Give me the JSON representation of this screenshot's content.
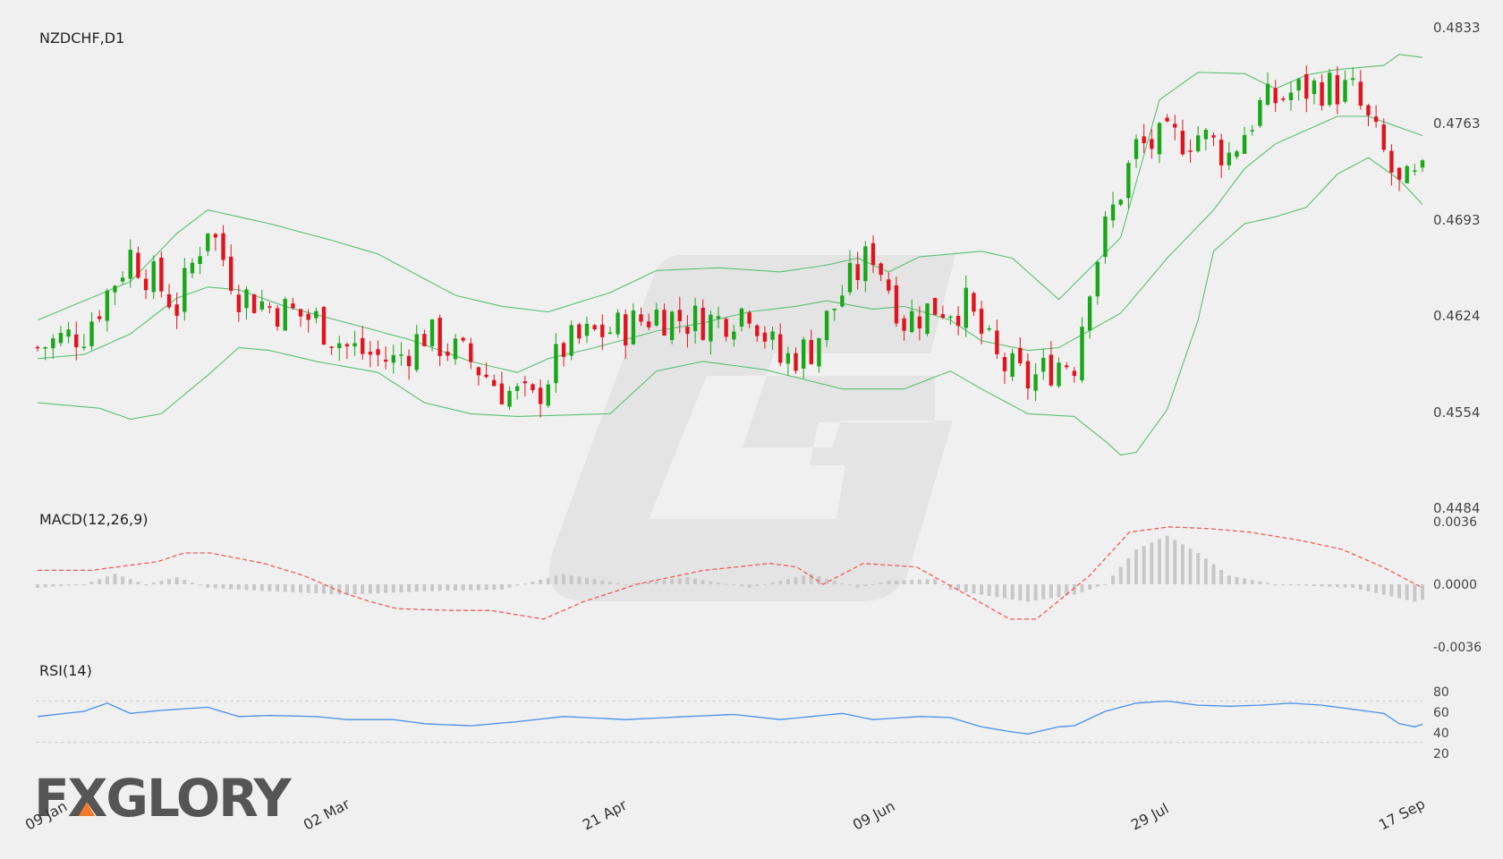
{
  "chart_data": [
    {
      "type": "candlestick",
      "title": "NZDCHF,D1",
      "y_ticks": [
        "0.4833",
        "0.4763",
        "0.4693",
        "0.4624",
        "0.4554",
        "0.4484"
      ],
      "ylim": [
        0.4484,
        0.4833
      ],
      "x_tick_labels": [
        "09 Jan",
        "02 Mar",
        "21 Apr",
        "09 Jun",
        "29 Jul",
        "17 Sep"
      ],
      "bar_count": 180,
      "colors": {
        "up": "#19a619",
        "down": "#e0141e",
        "bollinger": "#5cbf74"
      },
      "bollinger": {
        "upper_anchors": [
          [
            0,
            0.462
          ],
          [
            12,
            0.4648
          ],
          [
            18,
            0.4683
          ],
          [
            22,
            0.47
          ],
          [
            26,
            0.4695
          ],
          [
            30,
            0.469
          ],
          [
            38,
            0.4678
          ],
          [
            44,
            0.4668
          ],
          [
            48,
            0.4656
          ],
          [
            54,
            0.4638
          ],
          [
            60,
            0.463
          ],
          [
            66,
            0.4626
          ],
          [
            74,
            0.464
          ],
          [
            80,
            0.4656
          ],
          [
            88,
            0.4658
          ],
          [
            96,
            0.4655
          ],
          [
            102,
            0.466
          ],
          [
            106,
            0.4665
          ],
          [
            110,
            0.4655
          ],
          [
            114,
            0.4666
          ],
          [
            118,
            0.4668
          ],
          [
            122,
            0.467
          ],
          [
            126,
            0.4665
          ],
          [
            128,
            0.4655
          ],
          [
            132,
            0.4635
          ],
          [
            140,
            0.468
          ],
          [
            145,
            0.478
          ],
          [
            150,
            0.48
          ],
          [
            156,
            0.4799
          ],
          [
            160,
            0.4788
          ],
          [
            164,
            0.4798
          ],
          [
            168,
            0.4802
          ],
          [
            174,
            0.4805
          ],
          [
            176,
            0.4813
          ],
          [
            180,
            0.481
          ]
        ],
        "middle_anchors": [
          [
            0,
            0.4592
          ],
          [
            6,
            0.4595
          ],
          [
            12,
            0.461
          ],
          [
            18,
            0.4636
          ],
          [
            22,
            0.4644
          ],
          [
            26,
            0.4642
          ],
          [
            32,
            0.463
          ],
          [
            40,
            0.4618
          ],
          [
            48,
            0.4606
          ],
          [
            56,
            0.459
          ],
          [
            62,
            0.4582
          ],
          [
            66,
            0.4592
          ],
          [
            72,
            0.46
          ],
          [
            80,
            0.4612
          ],
          [
            86,
            0.4618
          ],
          [
            92,
            0.4626
          ],
          [
            98,
            0.463
          ],
          [
            102,
            0.4634
          ],
          [
            108,
            0.4628
          ],
          [
            112,
            0.463
          ],
          [
            118,
            0.462
          ],
          [
            122,
            0.4605
          ],
          [
            128,
            0.4598
          ],
          [
            132,
            0.46
          ],
          [
            140,
            0.4625
          ],
          [
            146,
            0.4665
          ],
          [
            152,
            0.47
          ],
          [
            156,
            0.473
          ],
          [
            160,
            0.4748
          ],
          [
            164,
            0.4758
          ],
          [
            168,
            0.4768
          ],
          [
            172,
            0.4768
          ],
          [
            176,
            0.476
          ],
          [
            180,
            0.4752
          ]
        ],
        "lower_anchors": [
          [
            0,
            0.456
          ],
          [
            8,
            0.4556
          ],
          [
            12,
            0.4548
          ],
          [
            16,
            0.4552
          ],
          [
            22,
            0.458
          ],
          [
            26,
            0.46
          ],
          [
            30,
            0.4598
          ],
          [
            36,
            0.459
          ],
          [
            44,
            0.4582
          ],
          [
            50,
            0.456
          ],
          [
            56,
            0.4552
          ],
          [
            62,
            0.455
          ],
          [
            74,
            0.4552
          ],
          [
            80,
            0.4583
          ],
          [
            86,
            0.459
          ],
          [
            94,
            0.4584
          ],
          [
            104,
            0.457
          ],
          [
            112,
            0.457
          ],
          [
            118,
            0.4583
          ],
          [
            122,
            0.457
          ],
          [
            128,
            0.4552
          ],
          [
            134,
            0.455
          ],
          [
            138,
            0.4532
          ],
          [
            140,
            0.4522
          ],
          [
            142,
            0.4524
          ],
          [
            146,
            0.4555
          ],
          [
            150,
            0.462
          ],
          [
            152,
            0.467
          ],
          [
            156,
            0.469
          ],
          [
            160,
            0.4695
          ],
          [
            164,
            0.4702
          ],
          [
            168,
            0.4726
          ],
          [
            172,
            0.4738
          ],
          [
            176,
            0.4722
          ],
          [
            180,
            0.4698
          ]
        ]
      },
      "price_anchors": [
        [
          0,
          0.46
        ],
        [
          6,
          0.4612
        ],
        [
          12,
          0.4668
        ],
        [
          18,
          0.463
        ],
        [
          22,
          0.469
        ],
        [
          26,
          0.464
        ],
        [
          30,
          0.463
        ],
        [
          36,
          0.462
        ],
        [
          40,
          0.46
        ],
        [
          46,
          0.459
        ],
        [
          50,
          0.461
        ],
        [
          56,
          0.459
        ],
        [
          60,
          0.457
        ],
        [
          64,
          0.456
        ],
        [
          68,
          0.46
        ],
        [
          72,
          0.461
        ],
        [
          76,
          0.4615
        ],
        [
          80,
          0.4625
        ],
        [
          84,
          0.462
        ],
        [
          88,
          0.462
        ],
        [
          92,
          0.463
        ],
        [
          96,
          0.459
        ],
        [
          100,
          0.46
        ],
        [
          104,
          0.464
        ],
        [
          108,
          0.467
        ],
        [
          112,
          0.462
        ],
        [
          116,
          0.463
        ],
        [
          120,
          0.463
        ],
        [
          124,
          0.459
        ],
        [
          128,
          0.4575
        ],
        [
          132,
          0.459
        ],
        [
          134,
          0.459
        ],
        [
          136,
          0.465
        ],
        [
          138,
          0.4685
        ],
        [
          142,
          0.4745
        ],
        [
          150,
          0.4755
        ],
        [
          154,
          0.474
        ],
        [
          158,
          0.4775
        ],
        [
          162,
          0.4785
        ],
        [
          166,
          0.479
        ],
        [
          170,
          0.4785
        ],
        [
          174,
          0.474
        ],
        [
          176,
          0.4715
        ],
        [
          180,
          0.4725
        ]
      ]
    },
    {
      "type": "line",
      "title": "MACD(12,26,9)",
      "y_ticks": [
        "0.0036",
        "0.0000",
        "-0.0036"
      ],
      "ylim": [
        -0.0036,
        0.0036
      ],
      "colors": {
        "signal": "#f05a5a",
        "histogram": "#c8c8c8"
      },
      "signal_anchors": [
        [
          0,
          0.0008
        ],
        [
          8,
          0.0008
        ],
        [
          12,
          0.001
        ],
        [
          18,
          0.0013
        ],
        [
          22,
          0.0018
        ],
        [
          26,
          0.0018
        ],
        [
          34,
          0.0012
        ],
        [
          40,
          0.0005
        ],
        [
          46,
          -0.0005
        ],
        [
          50,
          -0.001
        ],
        [
          54,
          -0.0014
        ],
        [
          62,
          -0.0015
        ],
        [
          68,
          -0.0015
        ],
        [
          76,
          -0.002
        ],
        [
          82,
          -0.001
        ],
        [
          90,
          0.0
        ],
        [
          100,
          0.0008
        ],
        [
          110,
          0.0012
        ],
        [
          114,
          0.001
        ],
        [
          118,
          0.0
        ],
        [
          124,
          0.0012
        ],
        [
          132,
          0.001
        ],
        [
          140,
          -0.0007
        ],
        [
          146,
          -0.002
        ],
        [
          150,
          -0.002
        ],
        [
          158,
          0.0005
        ],
        [
          164,
          0.003
        ],
        [
          170,
          0.0033
        ],
        [
          176,
          0.0032
        ],
        [
          182,
          0.003
        ],
        [
          190,
          0.0025
        ],
        [
          196,
          0.002
        ],
        [
          202,
          0.001
        ],
        [
          208,
          -0.0002
        ]
      ],
      "histogram_anchors": [
        [
          0,
          -0.0002
        ],
        [
          6,
          0.0
        ],
        [
          10,
          0.0006
        ],
        [
          14,
          0.0
        ],
        [
          18,
          0.0004
        ],
        [
          22,
          -0.0002
        ],
        [
          30,
          -0.0004
        ],
        [
          40,
          -0.0006
        ],
        [
          50,
          -0.0004
        ],
        [
          60,
          -0.0003
        ],
        [
          68,
          0.0006
        ],
        [
          76,
          0.0
        ],
        [
          84,
          0.0004
        ],
        [
          92,
          -0.0002
        ],
        [
          100,
          0.0006
        ],
        [
          106,
          -0.0002
        ],
        [
          110,
          0.0002
        ],
        [
          116,
          0.0003
        ],
        [
          118,
          -0.0003
        ],
        [
          122,
          -0.0006
        ],
        [
          128,
          -0.001
        ],
        [
          134,
          -0.0006
        ],
        [
          138,
          0.0
        ],
        [
          142,
          0.002
        ],
        [
          146,
          0.0028
        ],
        [
          150,
          0.0018
        ],
        [
          154,
          0.0005
        ],
        [
          160,
          0.0
        ],
        [
          170,
          -0.0002
        ],
        [
          174,
          -0.0006
        ],
        [
          178,
          -0.001
        ],
        [
          180,
          -0.0008
        ]
      ]
    },
    {
      "type": "line",
      "title": "RSI(14)",
      "y_ticks": [
        "80",
        "60",
        "40",
        "20"
      ],
      "ylim": [
        20,
        80
      ],
      "levels": [
        70,
        30
      ],
      "color": "#4a8fe8",
      "anchors": [
        [
          0,
          55
        ],
        [
          6,
          60
        ],
        [
          9,
          68
        ],
        [
          12,
          58
        ],
        [
          16,
          61
        ],
        [
          22,
          64
        ],
        [
          26,
          55
        ],
        [
          30,
          56
        ],
        [
          36,
          55
        ],
        [
          40,
          52
        ],
        [
          46,
          52
        ],
        [
          50,
          48
        ],
        [
          56,
          46
        ],
        [
          62,
          50
        ],
        [
          68,
          55
        ],
        [
          76,
          52
        ],
        [
          84,
          55
        ],
        [
          90,
          57
        ],
        [
          96,
          52
        ],
        [
          100,
          55
        ],
        [
          104,
          58
        ],
        [
          108,
          52
        ],
        [
          114,
          55
        ],
        [
          118,
          54
        ],
        [
          122,
          45
        ],
        [
          126,
          40
        ],
        [
          128,
          38
        ],
        [
          132,
          45
        ],
        [
          134,
          46
        ],
        [
          138,
          60
        ],
        [
          142,
          68
        ],
        [
          146,
          70
        ],
        [
          150,
          66
        ],
        [
          154,
          65
        ],
        [
          158,
          66
        ],
        [
          162,
          68
        ],
        [
          166,
          66
        ],
        [
          170,
          62
        ],
        [
          174,
          58
        ],
        [
          176,
          48
        ],
        [
          178,
          45
        ],
        [
          180,
          50
        ]
      ]
    }
  ],
  "watermark": {
    "logo_text": "FXGLORY"
  }
}
